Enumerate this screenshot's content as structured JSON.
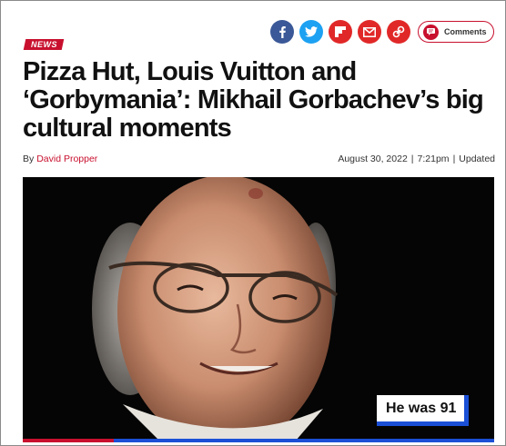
{
  "share": {
    "icons": [
      {
        "name": "facebook",
        "color": "#3b5998"
      },
      {
        "name": "twitter",
        "color": "#1da1f2"
      },
      {
        "name": "flipboard",
        "color": "#e12828"
      },
      {
        "name": "email",
        "color": "#e12828"
      },
      {
        "name": "link",
        "color": "#e12828"
      }
    ],
    "comments_label": "Comments"
  },
  "article": {
    "tag": "NEWS",
    "headline": "Pizza Hut, Louis Vuitton and ‘Gorbymania’: Mikhail Gorbachev’s big cultural moments",
    "byline_prefix": "By",
    "author": "David Propper",
    "date": "August 30, 2022",
    "time": "7:21pm",
    "updated_label": "Updated"
  },
  "photo": {
    "caption": "He was 91",
    "accent_color": "#1a4fd6"
  },
  "colors": {
    "brand_red": "#c8102e"
  }
}
